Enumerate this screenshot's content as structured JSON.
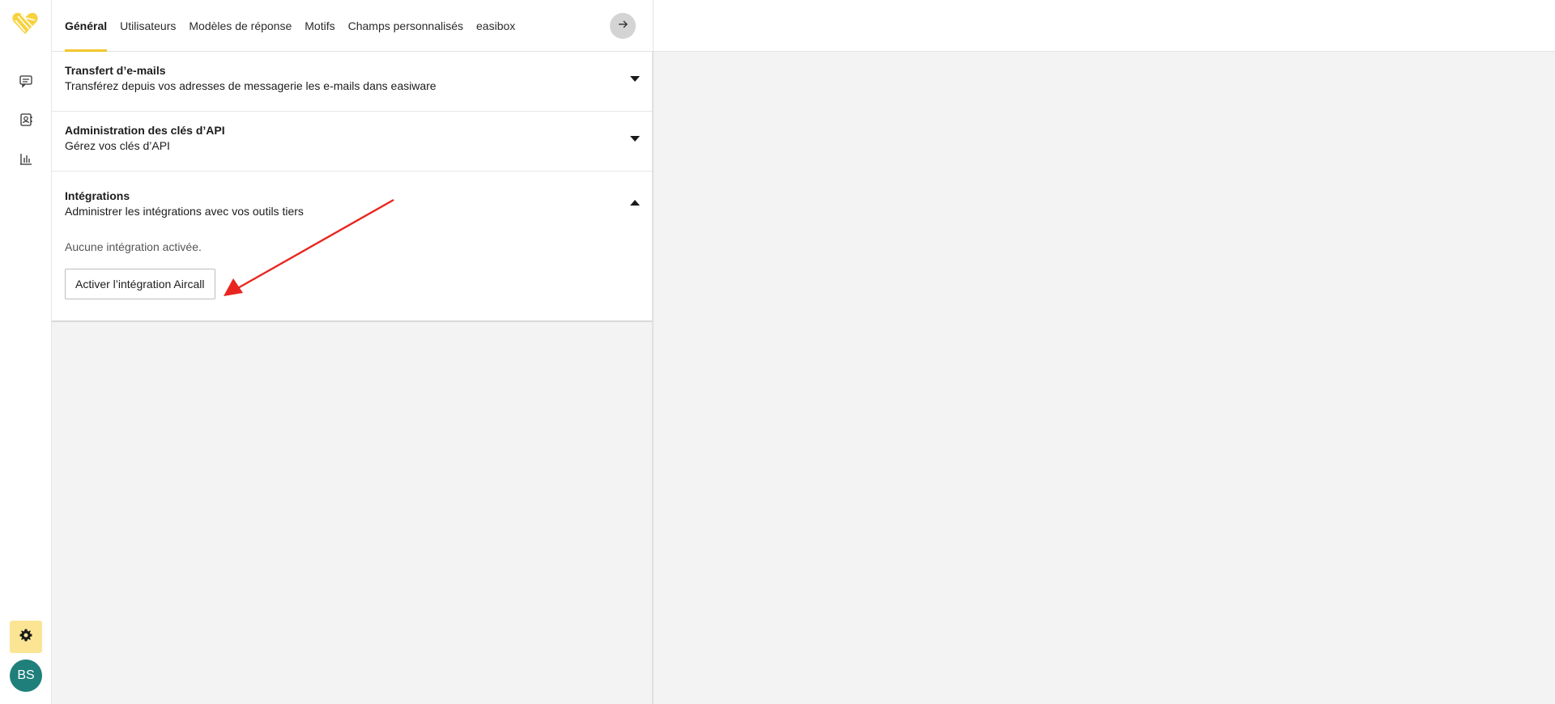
{
  "tabs": [
    {
      "label": "Général",
      "active": true
    },
    {
      "label": "Utilisateurs",
      "active": false
    },
    {
      "label": "Modèles de réponse",
      "active": false
    },
    {
      "label": "Motifs",
      "active": false
    },
    {
      "label": "Champs personnalisés",
      "active": false
    },
    {
      "label": "easibox",
      "active": false
    }
  ],
  "sidebar": {
    "logo_icon": "heart-logo-icon",
    "nav": [
      {
        "icon": "conversations-icon"
      },
      {
        "icon": "contacts-icon"
      },
      {
        "icon": "stats-icon"
      }
    ],
    "settings_icon": "gear-icon",
    "avatar_initials": "BS"
  },
  "sections": [
    {
      "title": "Transfert d’e-mails",
      "subtitle": "Transférez depuis vos adresses de messagerie les e-mails dans easiware",
      "expanded": false
    },
    {
      "title": "Administration des clés d’API",
      "subtitle": "Gérez vos clés d’API",
      "expanded": false
    },
    {
      "title": "Intégrations",
      "subtitle": "Administrer les intégrations avec vos outils tiers",
      "expanded": true,
      "empty_text": "Aucune intégration activée.",
      "button_label": "Activer l’intégration Aircall"
    }
  ],
  "colors": {
    "accent_yellow": "#f2c62b",
    "settings_bg": "#fbe594",
    "avatar_bg": "#1f7f7a",
    "annotation_red": "#e8261f"
  }
}
